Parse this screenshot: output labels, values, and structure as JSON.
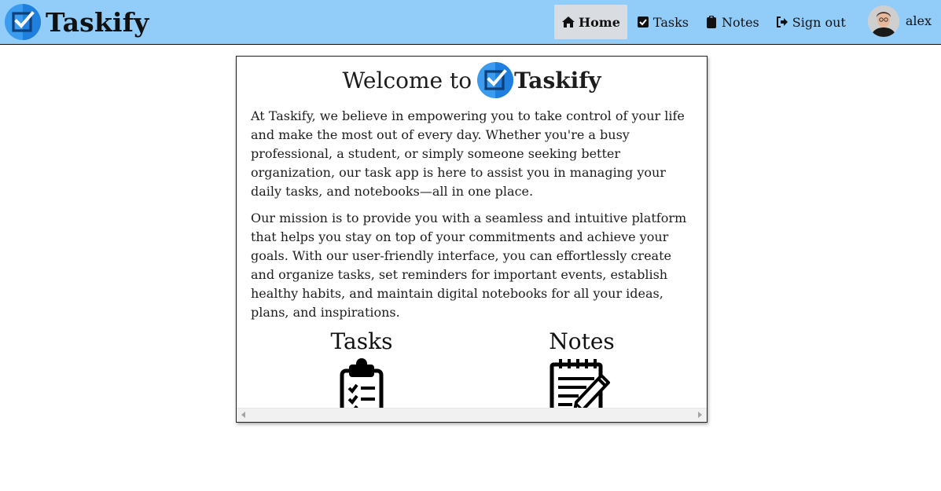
{
  "brand": {
    "name": "Taskify",
    "logo_icon": "checkbox-logo-icon",
    "colors": {
      "logo_light": "#42a5f5",
      "logo_dark": "#1e7ad6",
      "nav_bg": "#92cdf9"
    }
  },
  "nav": {
    "items": [
      {
        "label": "Home",
        "icon": "home-icon",
        "active": true
      },
      {
        "label": "Tasks",
        "icon": "checkbox-icon",
        "active": false
      },
      {
        "label": "Notes",
        "icon": "clipboard-icon",
        "active": false
      },
      {
        "label": "Sign out",
        "icon": "sign-out-icon",
        "active": false
      }
    ],
    "user": {
      "name": "alex",
      "avatar_icon": "user-avatar"
    }
  },
  "main": {
    "welcome_text": "Welcome to",
    "welcome_brand": "Taskify",
    "paragraphs": [
      "At Taskify, we believe in empowering you to take control of your life and make the most out of every day. Whether you're a busy professional, a student, or simply someone seeking better organization, our task app is here to assist you in managing your daily tasks, and notebooks—all in one place.",
      "Our mission is to provide you with a seamless and intuitive platform that helps you stay on top of your commitments and achieve your goals. With our user-friendly interface, you can effortlessly create and organize tasks, set reminders for important events, establish healthy habits, and maintain digital notebooks for all your ideas, plans, and inspirations."
    ],
    "features": [
      {
        "title": "Tasks",
        "icon": "clipboard-checklist-icon"
      },
      {
        "title": "Notes",
        "icon": "notepad-pencil-icon"
      }
    ]
  }
}
